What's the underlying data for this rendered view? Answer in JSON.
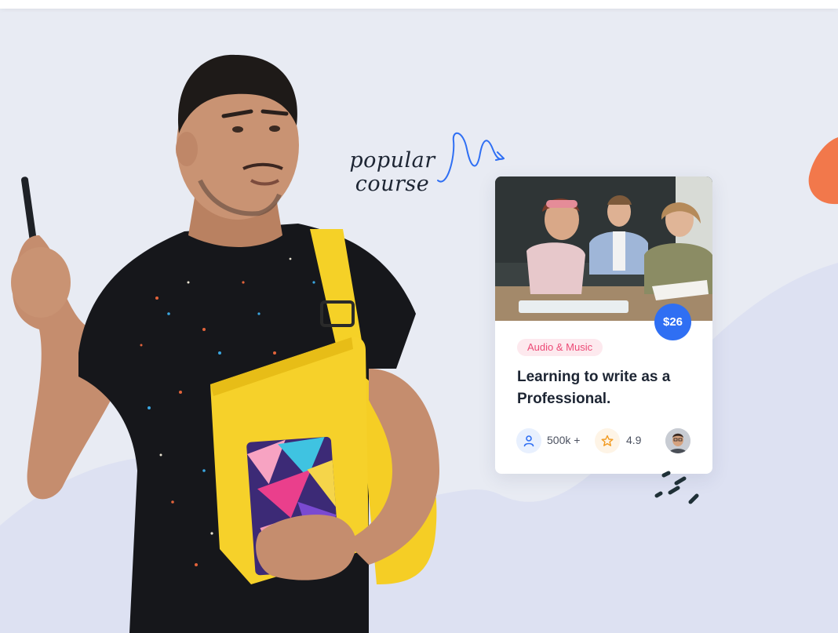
{
  "popular_note": {
    "line1": "popular",
    "line2": "course"
  },
  "course_card": {
    "price": "$26",
    "category": "Audio & Music",
    "title": "Learning to write as a Professional.",
    "students": "500k +",
    "rating": "4.9",
    "icons": {
      "students": "user-icon",
      "rating": "star-icon",
      "instructor": "avatar"
    }
  },
  "colors": {
    "background": "#e8ebf3",
    "accent_blue": "#2f6ff3",
    "tag_pink": "#ec4a76",
    "blob_orange": "#f2784b",
    "wave": "#d9def1",
    "book_yellow": "#f6d12a"
  }
}
